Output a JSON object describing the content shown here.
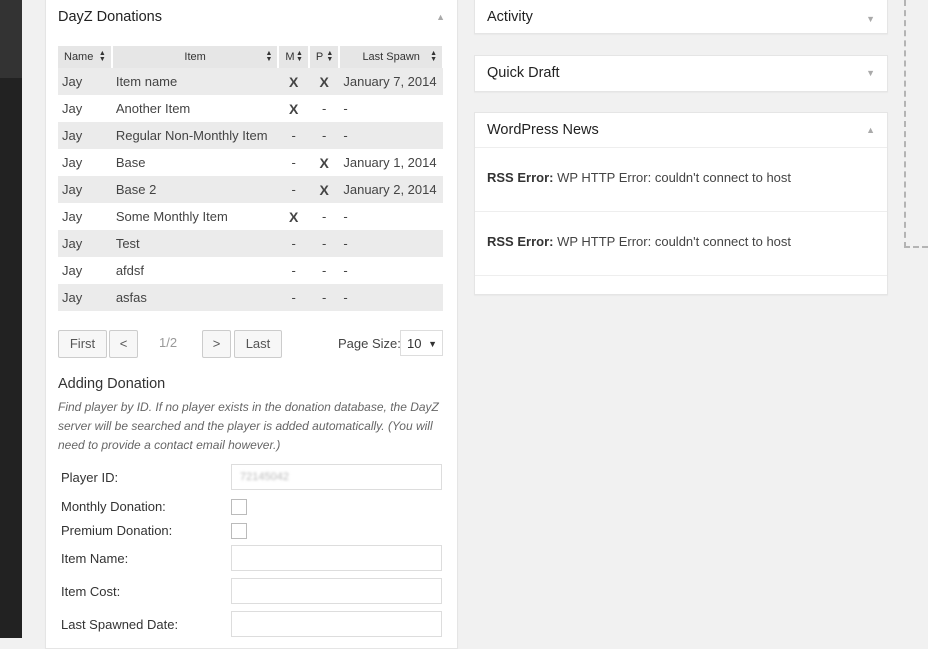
{
  "dayz": {
    "title": "DayZ Donations",
    "columns": [
      "Name",
      "Item",
      "M",
      "P",
      "Last Spawn"
    ],
    "rows": [
      {
        "name": "Jay",
        "item": "Item name",
        "m": "X",
        "p": "X",
        "last": "January 7, 2014"
      },
      {
        "name": "Jay",
        "item": "Another Item",
        "m": "X",
        "p": "-",
        "last": "-"
      },
      {
        "name": "Jay",
        "item": "Regular Non-Monthly Item",
        "m": "-",
        "p": "-",
        "last": "-"
      },
      {
        "name": "Jay",
        "item": "Base",
        "m": "-",
        "p": "X",
        "last": "January 1, 2014"
      },
      {
        "name": "Jay",
        "item": "Base 2",
        "m": "-",
        "p": "X",
        "last": "January 2, 2014"
      },
      {
        "name": "Jay",
        "item": "Some Monthly Item",
        "m": "X",
        "p": "-",
        "last": "-"
      },
      {
        "name": "Jay",
        "item": "Test",
        "m": "-",
        "p": "-",
        "last": "-"
      },
      {
        "name": "Jay",
        "item": "afdsf",
        "m": "-",
        "p": "-",
        "last": "-"
      },
      {
        "name": "Jay",
        "item": "asfas",
        "m": "-",
        "p": "-",
        "last": "-"
      }
    ],
    "pager": {
      "first": "First",
      "prev": "<",
      "indicator": "1/2",
      "next": ">",
      "last": "Last",
      "page_size_label": "Page Size:",
      "page_size_value": "10"
    },
    "add": {
      "title": "Adding Donation",
      "description": "Find player by ID. If no player exists in the donation database, the DayZ server will be searched and the player is added automatically. (You will need to provide a contact email however.)",
      "player_id_label": "Player ID:",
      "player_id_value": "72145042",
      "monthly_label": "Monthly Donation:",
      "premium_label": "Premium Donation:",
      "item_name_label": "Item Name:",
      "item_cost_label": "Item Cost:",
      "last_spawned_label": "Last Spawned Date:"
    }
  },
  "activity": {
    "title": "Activity"
  },
  "quick_draft": {
    "title": "Quick Draft"
  },
  "news": {
    "title": "WordPress News",
    "items": [
      {
        "label": "RSS Error:",
        "text": "WP HTTP Error: couldn't connect to host"
      },
      {
        "label": "RSS Error:",
        "text": "WP HTTP Error: couldn't connect to host"
      }
    ]
  },
  "icons": {
    "collapse": "triangle-up-icon",
    "expand": "triangle-down-icon",
    "sort": "sort-arrows-icon",
    "dropdown": "caret-down-icon"
  },
  "colors": {
    "red_mark": "#cc0000",
    "green_mark": "#2a8a2a",
    "admin_bar": "#222222"
  }
}
